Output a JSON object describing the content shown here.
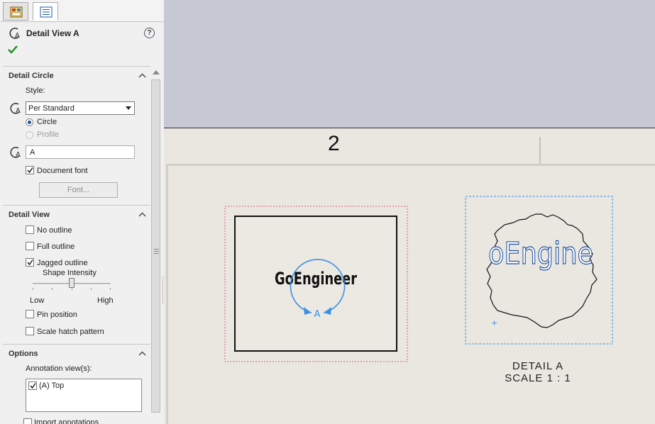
{
  "panel": {
    "title": "Detail View A",
    "help": "?",
    "detail_circle": {
      "heading": "Detail Circle",
      "style_label": "Style:",
      "style_value": "Per Standard",
      "radio_circle": "Circle",
      "radio_profile": "Profile",
      "label_value": "A",
      "document_font": "Document font",
      "font_button": "Font..."
    },
    "detail_view": {
      "heading": "Detail View",
      "no_outline": "No outline",
      "full_outline": "Full outline",
      "jagged_outline": "Jagged outline",
      "shape_intensity": "Shape Intensity",
      "slider_level": 0.5,
      "low": "Low",
      "high": "High",
      "pin_position": "Pin position",
      "scale_hatch": "Scale hatch pattern"
    },
    "options": {
      "heading": "Options",
      "annotation_views": "Annotation view(s):",
      "list_items": [
        "(A) Top"
      ],
      "import_annotations": "Import annotations"
    }
  },
  "canvas": {
    "zone_number": "2",
    "view_text": "GoEngineer",
    "circle_label": "A",
    "detail_text": "oEngine",
    "detail_caption_line1": "DETAIL A",
    "detail_caption_line2": "SCALE 1 : 1"
  },
  "colors": {
    "accent_blue": "#3d8fe6",
    "check_green": "#1e8a1e",
    "view_frame_red": "#e06070",
    "detail_frame_blue": "#3d8fe6"
  }
}
